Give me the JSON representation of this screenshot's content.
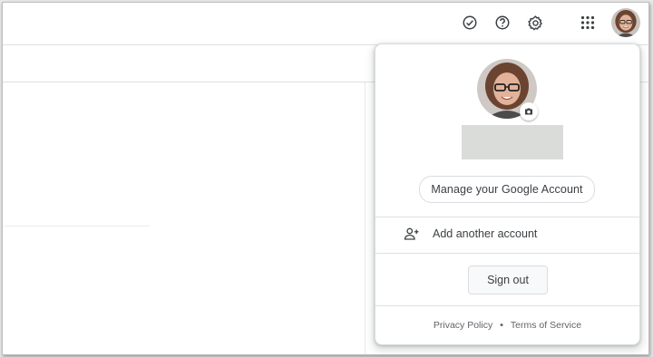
{
  "toolbar": {
    "icons": [
      "check-circle-icon",
      "help-icon",
      "settings-icon",
      "apps-grid-icon"
    ]
  },
  "account_menu": {
    "manage_label": "Manage your Google Account",
    "add_account_label": "Add another account",
    "sign_out_label": "Sign out",
    "footer": {
      "privacy": "Privacy Policy",
      "separator": "•",
      "terms": "Terms of Service"
    }
  },
  "colors": {
    "text": "#3c4043",
    "muted": "#5f6368",
    "border": "#dadce0",
    "name_placeholder": "#d9dcd8"
  }
}
